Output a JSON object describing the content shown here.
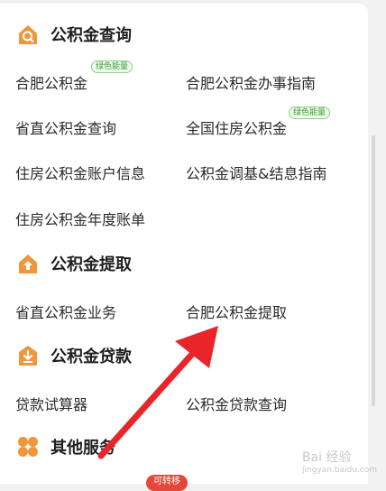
{
  "sections": {
    "query": {
      "title": "公积金查询",
      "icon": "search-house-icon",
      "items": [
        "合肥公积金",
        "合肥公积金办事指南",
        "省直公积金查询",
        "全国住房公积金",
        "住房公积金账户信息",
        "公积金调基&结息指南",
        "住房公积金年度账单"
      ]
    },
    "withdraw": {
      "title": "公积金提取",
      "icon": "house-up-icon",
      "items": [
        "省直公积金业务",
        "合肥公积金提取"
      ]
    },
    "loan": {
      "title": "公积金贷款",
      "icon": "download-box-icon",
      "items": [
        "贷款试算器",
        "公积金贷款查询"
      ]
    },
    "other": {
      "title": "其他服务",
      "icon": "four-dots-icon"
    }
  },
  "badges": {
    "green1": "绿色能量",
    "green2": "绿色能量",
    "red": "可转移"
  },
  "watermark": {
    "text": "Bai 经验",
    "sub": "jingyan.baidu.com"
  },
  "colors": {
    "icon": "#f0953a",
    "arrow": "#e8262a",
    "badge_green": "#3c9a36"
  }
}
